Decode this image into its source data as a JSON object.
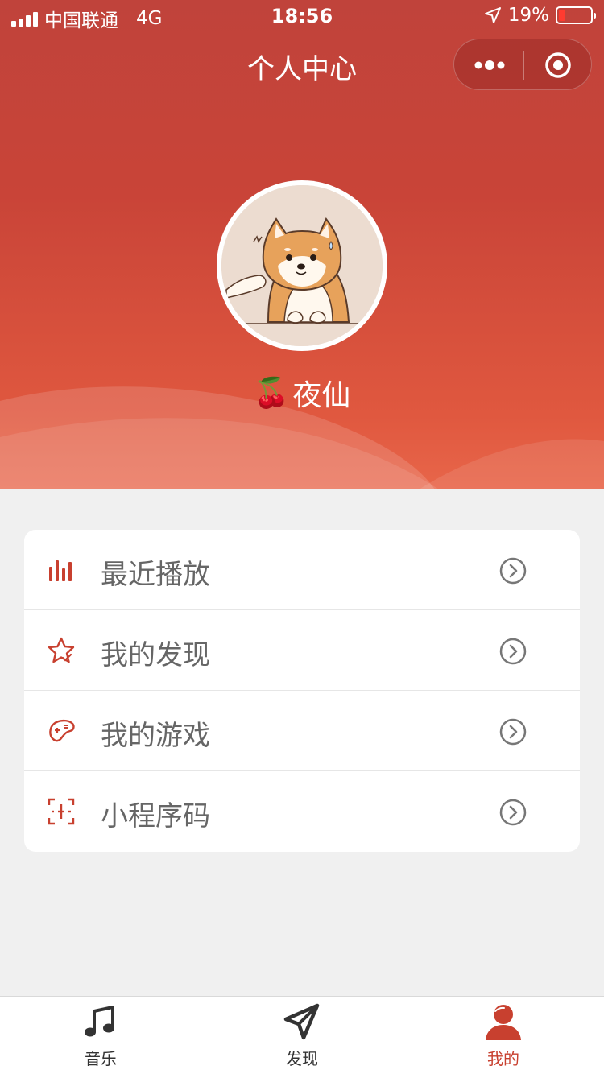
{
  "status_bar": {
    "carrier": "中国联通",
    "network": "4G",
    "time": "18:56",
    "battery": "19%"
  },
  "nav": {
    "title": "个人中心"
  },
  "profile": {
    "emoji": "🍒",
    "username": "夜仙"
  },
  "menu": {
    "items": [
      {
        "label": "最近播放",
        "icon": "bar-chart-icon"
      },
      {
        "label": "我的发现",
        "icon": "star-icon"
      },
      {
        "label": "我的游戏",
        "icon": "gamepad-icon"
      },
      {
        "label": "小程序码",
        "icon": "scan-icon"
      }
    ]
  },
  "tabbar": {
    "tabs": [
      {
        "label": "音乐",
        "icon": "music-note-icon"
      },
      {
        "label": "发现",
        "icon": "paper-plane-icon"
      },
      {
        "label": "我的",
        "icon": "user-icon",
        "active": true
      }
    ]
  },
  "colors": {
    "accent": "#c8402f",
    "header_top": "#c0433b",
    "header_bottom": "#e8664a",
    "background": "#f0f0f0"
  }
}
